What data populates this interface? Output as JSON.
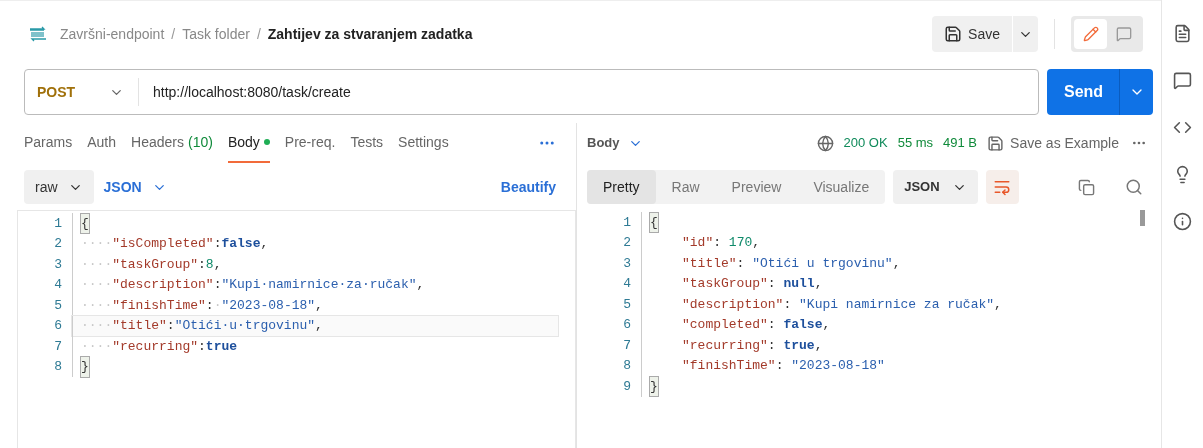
{
  "breadcrumb": [
    {
      "kind": "link",
      "text": "Završni-endpoint"
    },
    {
      "kind": "sep",
      "text": "/"
    },
    {
      "kind": "link",
      "text": "Task folder"
    },
    {
      "kind": "sep",
      "text": "/"
    },
    {
      "kind": "current",
      "text": "Zahtijev za stvaranjem zadatka"
    }
  ],
  "save": {
    "label": "Save"
  },
  "mode_toggle": [
    {
      "kind": "edit",
      "selected": true
    },
    {
      "kind": "comment",
      "selected": false
    }
  ],
  "request": {
    "method": "POST",
    "url": "http://localhost:8080/task/create",
    "send": "Send"
  },
  "request_tabs": [
    {
      "label": "Params",
      "selected": false,
      "has_content": false
    },
    {
      "label": "Auth",
      "selected": false,
      "has_content": false
    },
    {
      "label": "Headers",
      "count": "(10)",
      "selected": false,
      "has_content": false
    },
    {
      "label": "Body",
      "selected": true,
      "has_content": true
    },
    {
      "label": "Pre-req.",
      "selected": false,
      "has_content": false
    },
    {
      "label": "Tests",
      "selected": false,
      "has_content": false
    },
    {
      "label": "Settings",
      "selected": false,
      "has_content": false
    }
  ],
  "body_options": {
    "mode": "raw",
    "format": "JSON",
    "beautify": "Beautify"
  },
  "request_body": [
    {
      "num": "1",
      "active": false,
      "tokens": [
        {
          "kind": "brace",
          "t": "{"
        }
      ]
    },
    {
      "num": "2",
      "active": false,
      "tokens": [
        {
          "kind": "ws",
          "t": "····"
        },
        {
          "kind": "key",
          "t": "\"isCompleted\""
        },
        {
          "kind": "punct",
          "t": ":"
        },
        {
          "kind": "keyword",
          "t": "false"
        },
        {
          "kind": "punct",
          "t": ","
        }
      ]
    },
    {
      "num": "3",
      "active": false,
      "tokens": [
        {
          "kind": "ws",
          "t": "····"
        },
        {
          "kind": "key",
          "t": "\"taskGroup\""
        },
        {
          "kind": "punct",
          "t": ":"
        },
        {
          "kind": "number",
          "t": "8"
        },
        {
          "kind": "punct",
          "t": ","
        }
      ]
    },
    {
      "num": "4",
      "active": false,
      "tokens": [
        {
          "kind": "ws",
          "t": "····"
        },
        {
          "kind": "key",
          "t": "\"description\""
        },
        {
          "kind": "punct",
          "t": ":"
        },
        {
          "kind": "string",
          "t": "\"Kupi·namirnice·za·ručak\""
        },
        {
          "kind": "punct",
          "t": ","
        }
      ]
    },
    {
      "num": "5",
      "active": false,
      "tokens": [
        {
          "kind": "ws",
          "t": "····"
        },
        {
          "kind": "key",
          "t": "\"finishTime\""
        },
        {
          "kind": "punct",
          "t": ":"
        },
        {
          "kind": "ws",
          "t": "·"
        },
        {
          "kind": "string",
          "t": "\"2023-08-18\""
        },
        {
          "kind": "punct",
          "t": ","
        }
      ]
    },
    {
      "num": "6",
      "active": true,
      "tokens": [
        {
          "kind": "ws",
          "t": "····"
        },
        {
          "kind": "key",
          "t": "\"title\""
        },
        {
          "kind": "punct",
          "t": ":"
        },
        {
          "kind": "string",
          "t": "\"Otići·u·trgovinu\""
        },
        {
          "kind": "punct",
          "t": ","
        }
      ]
    },
    {
      "num": "7",
      "active": false,
      "tokens": [
        {
          "kind": "ws",
          "t": "····"
        },
        {
          "kind": "key",
          "t": "\"recurring\""
        },
        {
          "kind": "punct",
          "t": ":"
        },
        {
          "kind": "keyword",
          "t": "true"
        }
      ]
    },
    {
      "num": "8",
      "active": false,
      "tokens": [
        {
          "kind": "brace",
          "t": "}"
        }
      ]
    }
  ],
  "response": {
    "label": "Body",
    "status": "200 OK",
    "time": "55 ms",
    "size": "491 B",
    "save_example": "Save as Example",
    "views": [
      {
        "label": "Pretty",
        "selected": true
      },
      {
        "label": "Raw",
        "selected": false
      },
      {
        "label": "Preview",
        "selected": false
      },
      {
        "label": "Visualize",
        "selected": false
      }
    ],
    "format": "JSON",
    "wrap": true,
    "lines": [
      {
        "num": "1",
        "indented": false,
        "tokens": [
          {
            "kind": "brace",
            "t": "{"
          }
        ]
      },
      {
        "num": "2",
        "indented": true,
        "tokens": [
          {
            "kind": "key",
            "t": "\"id\""
          },
          {
            "kind": "punct",
            "t": ": "
          },
          {
            "kind": "number",
            "t": "170"
          },
          {
            "kind": "punct",
            "t": ","
          }
        ]
      },
      {
        "num": "3",
        "indented": true,
        "tokens": [
          {
            "kind": "key",
            "t": "\"title\""
          },
          {
            "kind": "punct",
            "t": ": "
          },
          {
            "kind": "string",
            "t": "\"Otići u trgovinu\""
          },
          {
            "kind": "punct",
            "t": ","
          }
        ]
      },
      {
        "num": "4",
        "indented": true,
        "tokens": [
          {
            "kind": "key",
            "t": "\"taskGroup\""
          },
          {
            "kind": "punct",
            "t": ": "
          },
          {
            "kind": "keyword",
            "t": "null"
          },
          {
            "kind": "punct",
            "t": ","
          }
        ]
      },
      {
        "num": "5",
        "indented": true,
        "tokens": [
          {
            "kind": "key",
            "t": "\"description\""
          },
          {
            "kind": "punct",
            "t": ": "
          },
          {
            "kind": "string",
            "t": "\"Kupi namirnice za ručak\""
          },
          {
            "kind": "punct",
            "t": ","
          }
        ]
      },
      {
        "num": "6",
        "indented": true,
        "tokens": [
          {
            "kind": "key",
            "t": "\"completed\""
          },
          {
            "kind": "punct",
            "t": ": "
          },
          {
            "kind": "keyword",
            "t": "false"
          },
          {
            "kind": "punct",
            "t": ","
          }
        ]
      },
      {
        "num": "7",
        "indented": true,
        "tokens": [
          {
            "kind": "key",
            "t": "\"recurring\""
          },
          {
            "kind": "punct",
            "t": ": "
          },
          {
            "kind": "keyword",
            "t": "true"
          },
          {
            "kind": "punct",
            "t": ","
          }
        ]
      },
      {
        "num": "8",
        "indented": true,
        "tokens": [
          {
            "kind": "key",
            "t": "\"finishTime\""
          },
          {
            "kind": "punct",
            "t": ": "
          },
          {
            "kind": "string",
            "t": "\"2023-08-18\""
          }
        ]
      },
      {
        "num": "9",
        "indented": false,
        "tokens": [
          {
            "kind": "brace",
            "t": "}"
          }
        ]
      }
    ]
  }
}
